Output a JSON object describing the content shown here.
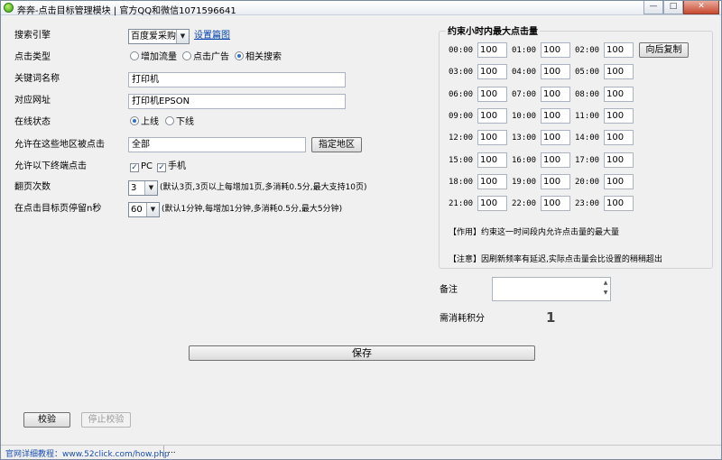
{
  "window": {
    "title": "奔奔-点击目标管理模块 | 官方QQ和微信1071596641",
    "min": "—",
    "max": "□",
    "close": "✕"
  },
  "form": {
    "engine_label": "搜索引擎",
    "engine_value": "百度爱采购",
    "engine_link": "设置篇图",
    "click_type_label": "点击类型",
    "click_type_options": [
      "增加流量",
      "点击广告",
      "相关搜索"
    ],
    "keyword_label": "关键词名称",
    "keyword_value": "打印机",
    "url_label": "对应网址",
    "url_value": "打印机EPSON",
    "status_label": "在线状态",
    "status_options": [
      "上线",
      "下线"
    ],
    "region_label": "允许在这些地区被点击",
    "region_value": "全部",
    "region_button": "指定地区",
    "terminal_label": "允许以下终端点击",
    "terminal_options": [
      "PC",
      "手机"
    ],
    "pages_label": "翻页次数",
    "pages_value": "3",
    "pages_hint": "(默认3页,3页以上每增加1页,多消耗0.5分,最大支持10页)",
    "stay_label": "在点击目标页停留n秒",
    "stay_value": "60",
    "stay_hint": "(默认1分钟,每增加1分钟,多消耗0.5分,最大5分钟)",
    "save_button": "保存"
  },
  "hourly": {
    "title": "约束小时内最大点击量",
    "copy_button": "向后复制",
    "slots": [
      {
        "time": "00:00",
        "value": "100"
      },
      {
        "time": "01:00",
        "value": "100"
      },
      {
        "time": "02:00",
        "value": "100"
      },
      {
        "time": "03:00",
        "value": "100"
      },
      {
        "time": "04:00",
        "value": "100"
      },
      {
        "time": "05:00",
        "value": "100"
      },
      {
        "time": "06:00",
        "value": "100"
      },
      {
        "time": "07:00",
        "value": "100"
      },
      {
        "time": "08:00",
        "value": "100"
      },
      {
        "time": "09:00",
        "value": "100"
      },
      {
        "time": "10:00",
        "value": "100"
      },
      {
        "time": "11:00",
        "value": "100"
      },
      {
        "time": "12:00",
        "value": "100"
      },
      {
        "time": "13:00",
        "value": "100"
      },
      {
        "time": "14:00",
        "value": "100"
      },
      {
        "time": "15:00",
        "value": "100"
      },
      {
        "time": "16:00",
        "value": "100"
      },
      {
        "time": "17:00",
        "value": "100"
      },
      {
        "time": "18:00",
        "value": "100"
      },
      {
        "time": "19:00",
        "value": "100"
      },
      {
        "time": "20:00",
        "value": "100"
      },
      {
        "time": "21:00",
        "value": "100"
      },
      {
        "time": "22:00",
        "value": "100"
      },
      {
        "time": "23:00",
        "value": "100"
      }
    ],
    "note_effect": "【作用】约束这一时间段内允许点击量的最大量",
    "note_warning": "【注意】因刷新频率有延迟,实际点击量会比设置的稍稍超出"
  },
  "remark": {
    "label": "备注",
    "value": ""
  },
  "cost": {
    "label": "需消耗积分",
    "value": "1"
  },
  "bottom": {
    "verify_button": "校验",
    "stop_button": "停止校验"
  },
  "statusbar": {
    "link_text": "官网详细教程：www.52click.com/how.php",
    "extra": "..."
  },
  "colors": {
    "accent": "#2b6fc8",
    "link": "#0645ad"
  }
}
